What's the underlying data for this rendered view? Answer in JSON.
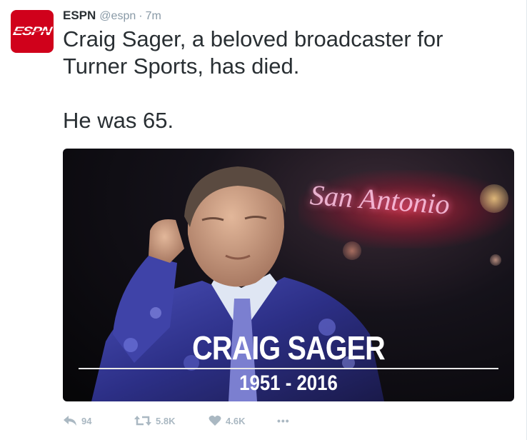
{
  "author": {
    "name": "ESPN",
    "handle": "@espn",
    "separator": "·",
    "time": "7m",
    "avatar_logo": "ESPN"
  },
  "tweet": {
    "text_line1": "Craig Sager, a beloved broadcaster for Turner Sports, has died.",
    "text_line2": "He was 65."
  },
  "media": {
    "banner_text": "San Antonio",
    "caption_name": "CRAIG SAGER",
    "caption_years": "1951 - 2016"
  },
  "actions": {
    "reply_count": "94",
    "retweet_count": "5.8K",
    "like_count": "4.6K",
    "more_label": "•••"
  },
  "colors": {
    "brand": "#d0011b",
    "text": "#292f33",
    "muted": "#8899a6",
    "action": "#aab8c2"
  }
}
